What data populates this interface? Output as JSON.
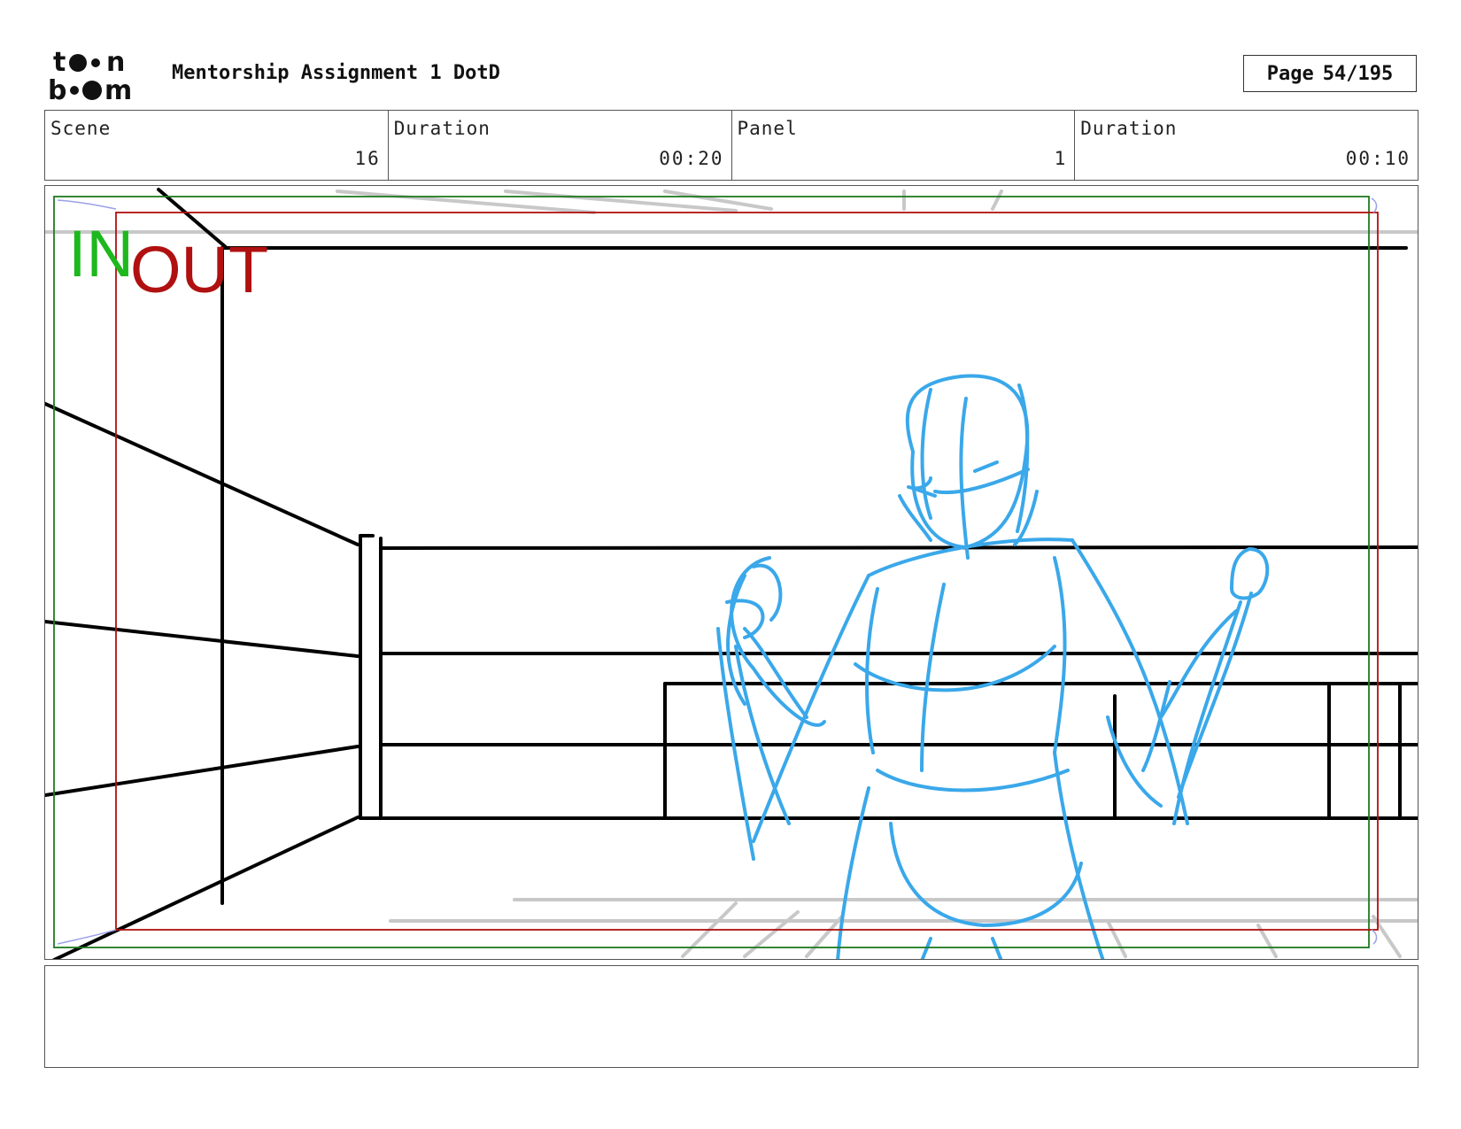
{
  "header": {
    "logo_text_top": "toon",
    "logo_text_bottom": "boom",
    "project_title": "Mentorship Assignment 1 DotD",
    "page_label": "Page",
    "page_value": "54/195"
  },
  "info": [
    {
      "label": "Scene",
      "value": "16"
    },
    {
      "label": "Duration",
      "value": "00:20"
    },
    {
      "label": "Panel",
      "value": "1"
    },
    {
      "label": "Duration",
      "value": "00:10"
    }
  ],
  "panel": {
    "in_label": "IN",
    "out_label": "OUT",
    "colors": {
      "safe_in": "#1f7a1f",
      "safe_out": "#b01010",
      "in_text": "#1db81d",
      "out_text": "#b01010",
      "sketch": "#3aa8ea",
      "ink": "#000000",
      "guide": "#c8c8c8"
    }
  },
  "notes": {
    "text": ""
  }
}
